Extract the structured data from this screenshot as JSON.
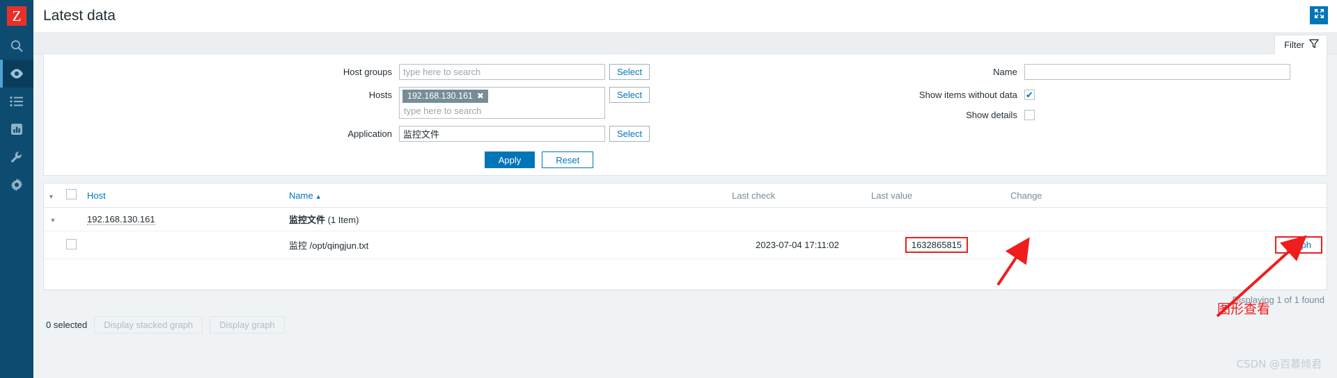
{
  "sidebar": {
    "logo_text": "Z",
    "items": [
      {
        "name": "search-icon",
        "label": "Search"
      },
      {
        "name": "monitoring-icon",
        "label": "Monitoring",
        "active": true
      },
      {
        "name": "inventory-icon",
        "label": "Inventory"
      },
      {
        "name": "reports-icon",
        "label": "Reports"
      },
      {
        "name": "configuration-icon",
        "label": "Configuration"
      },
      {
        "name": "administration-icon",
        "label": "Administration"
      }
    ]
  },
  "header": {
    "title": "Latest data",
    "kiosk_label": "Kiosk mode"
  },
  "filter": {
    "tab_label": "Filter",
    "host_groups": {
      "label": "Host groups",
      "value": "",
      "placeholder": "type here to search",
      "select_label": "Select"
    },
    "hosts": {
      "label": "Hosts",
      "chips": [
        "192.168.130.161"
      ],
      "placeholder": "type here to search",
      "select_label": "Select"
    },
    "application": {
      "label": "Application",
      "value": "监控文件",
      "placeholder": "",
      "select_label": "Select"
    },
    "name": {
      "label": "Name",
      "value": "",
      "placeholder": ""
    },
    "show_items_without_data": {
      "label": "Show items without data",
      "checked": true,
      "tick": "✔"
    },
    "show_details": {
      "label": "Show details",
      "checked": false,
      "tick": ""
    },
    "apply_label": "Apply",
    "reset_label": "Reset"
  },
  "table": {
    "columns": {
      "host": "Host",
      "name": "Name",
      "last_check": "Last check",
      "last_value": "Last value",
      "change": "Change"
    },
    "sort_indicator": "▲",
    "group_row": {
      "host": "192.168.130.161",
      "app_name": "监控文件",
      "app_count": "(1 Item)"
    },
    "item_row": {
      "name_prefix": "监控",
      "name_path": "/opt/qingjun.txt",
      "last_check": "2023-07-04 17:11:02",
      "last_value": "1632865815",
      "change": "",
      "graph_label": "Graph"
    },
    "footer_count": "Displaying 1 of 1 found"
  },
  "bulk": {
    "selected_label": "0 selected",
    "stacked_graph_label": "Display stacked graph",
    "graph_label": "Display graph"
  },
  "annotations": {
    "note_text": "图形查看",
    "highlight_color": "#ef1d1d",
    "arrow_color": "#ef1d1d"
  },
  "watermark": {
    "text": "CSDN @百慕倾君"
  }
}
